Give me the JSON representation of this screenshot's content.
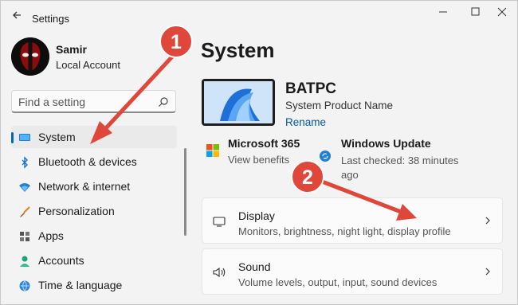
{
  "window": {
    "title": "Settings",
    "controls": [
      "minimize-icon",
      "maximize-icon",
      "close-icon"
    ]
  },
  "profile": {
    "name": "Samir",
    "account": "Local Account"
  },
  "search": {
    "placeholder": "Find a setting"
  },
  "nav": {
    "items": [
      {
        "label": "System",
        "icon": "monitor-icon",
        "selected": true
      },
      {
        "label": "Bluetooth & devices",
        "icon": "bluetooth-icon"
      },
      {
        "label": "Network & internet",
        "icon": "wifi-icon"
      },
      {
        "label": "Personalization",
        "icon": "brush-icon"
      },
      {
        "label": "Apps",
        "icon": "apps-icon"
      },
      {
        "label": "Accounts",
        "icon": "person-icon"
      },
      {
        "label": "Time & language",
        "icon": "globe-icon"
      }
    ]
  },
  "main": {
    "title": "System",
    "device": {
      "name": "BATPC",
      "model": "System Product Name",
      "rename": "Rename"
    },
    "microsoft365": {
      "title": "Microsoft 365",
      "subtitle": "View benefits"
    },
    "windows_update": {
      "title": "Windows Update",
      "subtitle": "Last checked: 38 minutes ago"
    },
    "cards": [
      {
        "title": "Display",
        "subtitle": "Monitors, brightness, night light, display profile",
        "icon": "display-icon"
      },
      {
        "title": "Sound",
        "subtitle": "Volume levels, output, input, sound devices",
        "icon": "speaker-icon"
      }
    ]
  },
  "annotations": {
    "step1": "1",
    "step2": "2"
  },
  "colors": {
    "accent": "#0067c0",
    "annotation": "#e0473b",
    "link": "#005a9e",
    "background": "#f3f3f3"
  }
}
